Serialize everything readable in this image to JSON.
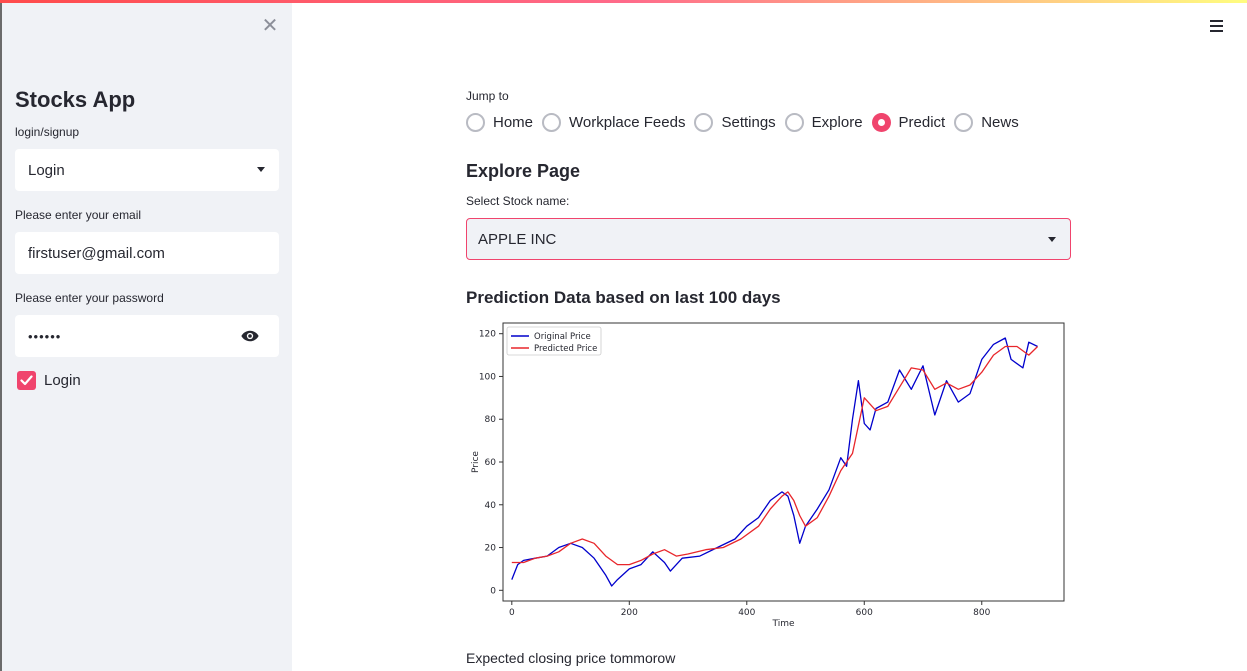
{
  "sidebar": {
    "title": "Stocks App",
    "auth_label": "login/signup",
    "auth_value": "Login",
    "email_label": "Please enter your email",
    "email_value": "firstuser@gmail.com",
    "password_label": "Please enter your password",
    "password_value": "••••••",
    "checkbox_label": "Login",
    "checkbox_checked": true
  },
  "icons": {
    "close": "close-icon",
    "menu": "hamburger-menu-icon",
    "password_toggle": "eye-icon",
    "dropdown": "chevron-down-icon"
  },
  "nav": {
    "jump_label": "Jump to",
    "options": [
      "Home",
      "Workplace Feeds",
      "Settings",
      "Explore",
      "Predict",
      "News"
    ],
    "selected": "Predict"
  },
  "main": {
    "page_title": "Explore Page",
    "stock_label": "Select Stock name:",
    "stock_value": "APPLE INC",
    "chart_heading": "Prediction Data based on last 100 days",
    "expected_text": "Expected closing price tommorow"
  },
  "colors": {
    "accent": "#f0446d",
    "sidebar_bg": "#f0f2f6",
    "original_line": "#0000cc",
    "predicted_line": "#e8262b"
  },
  "chart_data": {
    "type": "line",
    "title": "",
    "xlabel": "Time",
    "ylabel": "Price",
    "xlim": [
      -15,
      940
    ],
    "ylim": [
      -5,
      125
    ],
    "xticks": [
      0,
      200,
      400,
      600,
      800
    ],
    "yticks": [
      0,
      20,
      40,
      60,
      80,
      100,
      120
    ],
    "legend_position": "top-left",
    "series": [
      {
        "name": "Original Price",
        "color": "#0000cc",
        "x": [
          0,
          10,
          20,
          40,
          60,
          80,
          100,
          120,
          140,
          160,
          170,
          180,
          200,
          220,
          240,
          260,
          270,
          290,
          320,
          350,
          380,
          400,
          420,
          440,
          460,
          470,
          480,
          490,
          500,
          520,
          540,
          560,
          570,
          580,
          590,
          600,
          610,
          620,
          640,
          660,
          680,
          700,
          720,
          740,
          760,
          780,
          800,
          820,
          840,
          850,
          870,
          880,
          895
        ],
        "values": [
          5,
          12,
          14,
          15,
          16,
          20,
          22,
          20,
          15,
          7,
          2,
          5,
          10,
          12,
          18,
          13,
          9,
          15,
          16,
          20,
          24,
          30,
          34,
          42,
          46,
          44,
          35,
          22,
          30,
          38,
          47,
          62,
          58,
          80,
          98,
          78,
          75,
          85,
          88,
          103,
          94,
          105,
          82,
          98,
          88,
          92,
          108,
          115,
          118,
          108,
          104,
          116,
          114
        ]
      },
      {
        "name": "Predicted Price",
        "color": "#e8262b",
        "x": [
          0,
          20,
          40,
          60,
          80,
          100,
          120,
          140,
          160,
          180,
          200,
          220,
          240,
          260,
          280,
          300,
          330,
          360,
          390,
          420,
          440,
          460,
          470,
          480,
          490,
          500,
          520,
          540,
          560,
          580,
          600,
          620,
          640,
          660,
          680,
          700,
          720,
          740,
          760,
          780,
          800,
          820,
          840,
          860,
          880,
          895
        ],
        "values": [
          13,
          13,
          15,
          16,
          18,
          22,
          24,
          22,
          16,
          12,
          12,
          14,
          17,
          19,
          16,
          17,
          19,
          20,
          24,
          30,
          38,
          44,
          46,
          42,
          35,
          30,
          34,
          44,
          56,
          64,
          90,
          84,
          86,
          95,
          104,
          103,
          94,
          97,
          94,
          96,
          102,
          110,
          114,
          114,
          110,
          114
        ]
      }
    ]
  }
}
